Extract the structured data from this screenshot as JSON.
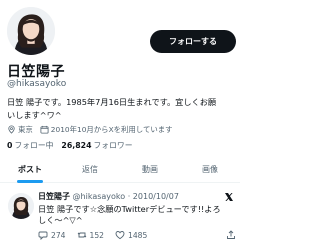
{
  "profile": {
    "name": "日笠陽子",
    "handle": "@hikasayoko",
    "follow_label": "フォローする",
    "bio_line1": "日笠 陽子です。1985年7月16日生まれです。宜しくお願",
    "bio_line2": "いします^ワ^",
    "location": "東京",
    "joined": "2010年10月からXを利用しています",
    "following_count": "0",
    "following_label": "フォロー中",
    "followers_count": "26,824",
    "followers_label": "フォロワー"
  },
  "tabs": [
    {
      "label": "ポスト",
      "active": true
    },
    {
      "label": "返信",
      "active": false
    },
    {
      "label": "動画",
      "active": false
    },
    {
      "label": "画像",
      "active": false
    }
  ],
  "tweet": {
    "name": "日笠陽子",
    "meta": "@hikasayoko · 2010/10/07",
    "text_line1": "日笠 陽子です☆念願のTwitterデビューです!!よろ",
    "text_line2": "しく～^▽^",
    "replies": "274",
    "reposts": "152",
    "likes": "1485"
  },
  "colors": {
    "accent": "#1d9bf0",
    "text": "#0f1419",
    "muted": "#536471"
  },
  "icons": [
    "location-icon",
    "calendar-icon",
    "x-logo-icon",
    "reply-icon",
    "repost-icon",
    "like-icon",
    "share-icon"
  ]
}
